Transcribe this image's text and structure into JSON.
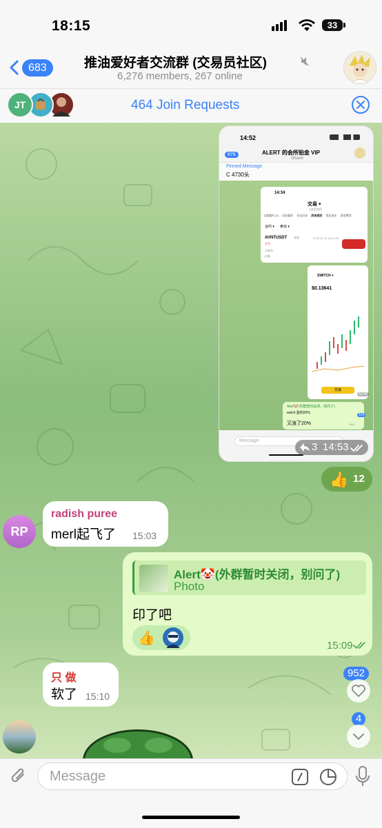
{
  "status": {
    "time": "18:15",
    "battery": "33"
  },
  "header": {
    "back_count": "683",
    "title": "推油爱好者交流群 (交易员社区)",
    "subtitle": "6,276 members, 267 online"
  },
  "join": {
    "avatar1": "JT",
    "text": "464 Join Requests"
  },
  "photo": {
    "time": "14:52",
    "chat_title": "ALERT 的会所铂金 VIP",
    "chat_sub": "Shawn",
    "back": "676",
    "pinned_label": "Pinned Message",
    "pinned_text": "C 4730头",
    "inner_time": "14:34",
    "exchange": "交易 ▾",
    "exchange_sub": "U本位合约",
    "tabs": [
      "当前委托 (0)",
      "历史委托",
      "仓位历史",
      "历史成交",
      "资金流水",
      "资金费用"
    ],
    "filter1": "合约 ▾",
    "filter2": "卖出 ▾",
    "symbol": "AVNTUSDT",
    "symbol_tag": "永续",
    "trade_time": "2025-09-16 18:24:20",
    "row2": "开空",
    "row3": "订单号",
    "row4": "价格",
    "chart_title": "SWITCH ▾",
    "chart_price": "$0.13641",
    "chart_btn": "交易",
    "inner_stamp": "14:36",
    "reply_name": "Alert🤡(外群暂时关闭，别问了)",
    "reply_sub": "swich 盈利20%",
    "reply_text": "又涨了20%",
    "reply_time": "14:4",
    "inner_count": "124",
    "inner_input": "Message",
    "forward_count": "3",
    "msg_time": "14:53"
  },
  "reaction1": {
    "emoji": "👍",
    "count": "12"
  },
  "msg1": {
    "avatar": "RP",
    "sender": "radish puree",
    "text": "merl起飞了",
    "time": "15:03"
  },
  "msg2": {
    "reply_name": "Alert🤡(外群暂时关闭，别问了)",
    "reply_type": "Photo",
    "text": "印了吧",
    "reaction": "👍",
    "time": "15:09"
  },
  "msg3": {
    "sender": "只 做",
    "text": "软了",
    "time": "15:10"
  },
  "side": {
    "likes": "952",
    "unread": "4"
  },
  "composer": {
    "placeholder": "Message"
  },
  "colors": {
    "accent": "#3a82f7",
    "outgoing": "#e4fac9",
    "incoming": "#ffffff",
    "sender_rp": "#c2417a",
    "sender_zz": "#d23a32"
  }
}
